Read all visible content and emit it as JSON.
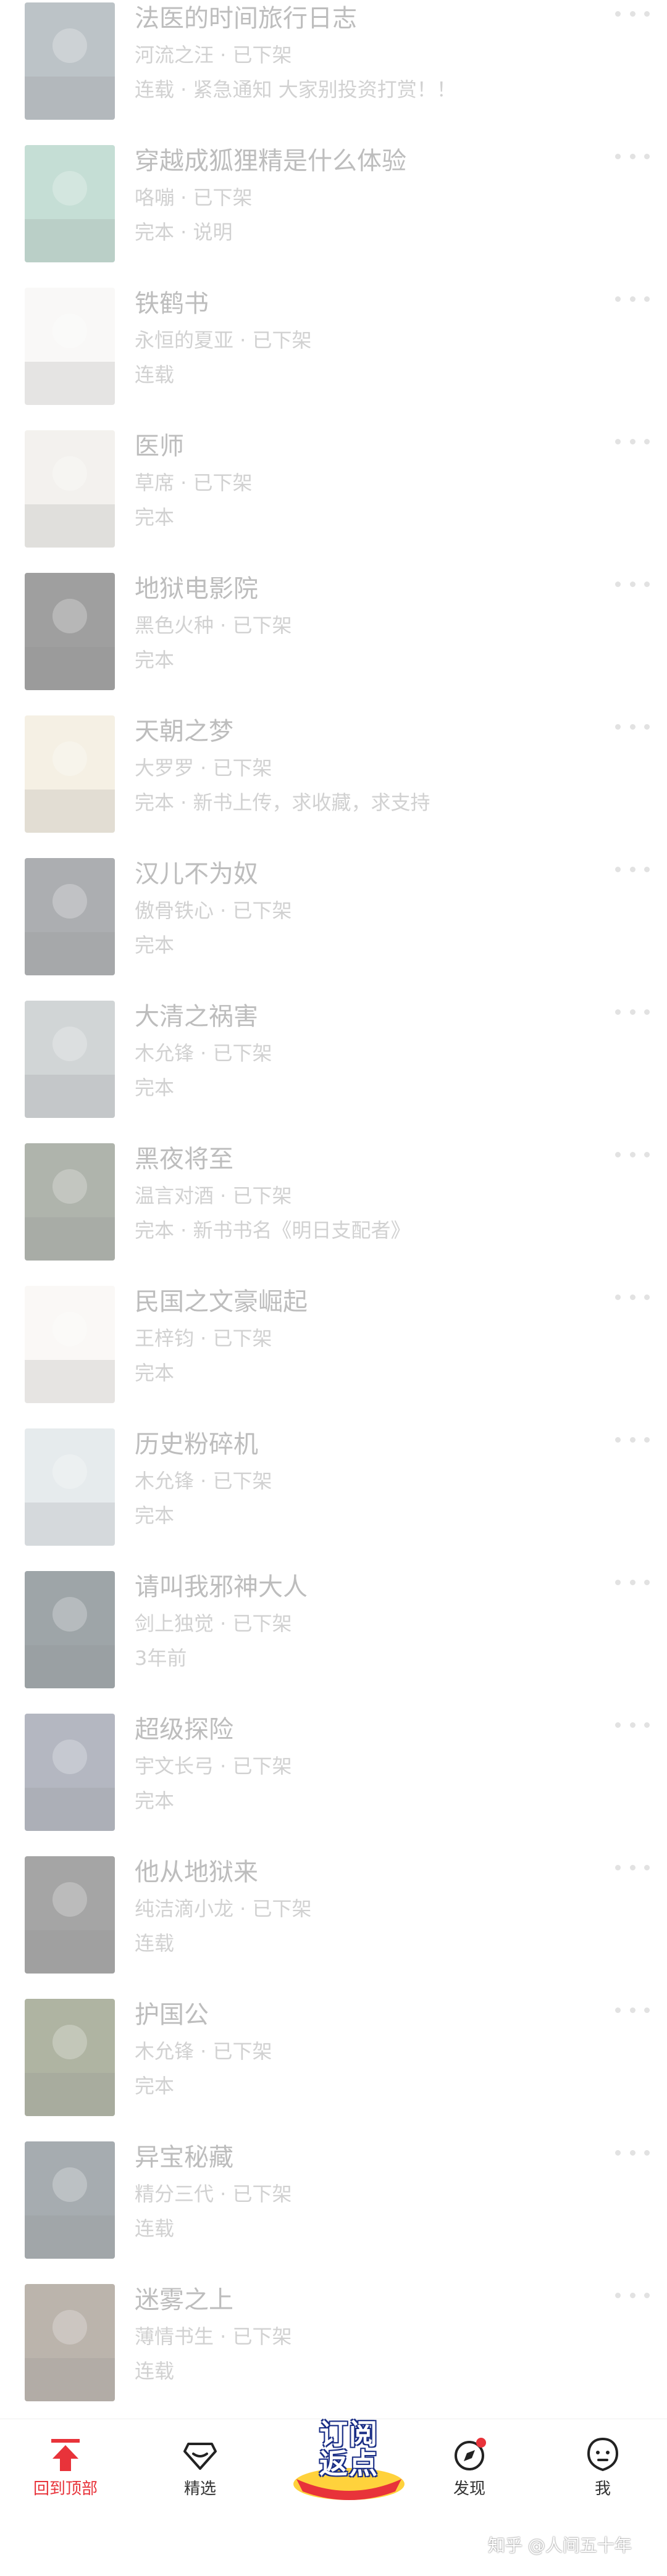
{
  "books": [
    {
      "title": "法医的时间旅行日志",
      "meta": "河流之汪 · 已下架",
      "status": "连载 · 紧急通知 大家别投资打赏！！",
      "cover_color": "#6d7b85"
    },
    {
      "title": "穿越成狐狸精是什么体验",
      "meta": "咯嘣 · 已下架",
      "status": "完本 · 说明",
      "cover_color": "#7fb7a3"
    },
    {
      "title": "铁鹤书",
      "meta": "永恒的夏亚 · 已下架",
      "status": "连载",
      "cover_color": "#f3f1ee"
    },
    {
      "title": "医师",
      "meta": "草席 · 已下架",
      "status": "完本",
      "cover_color": "#e6e2db"
    },
    {
      "title": "地狱电影院",
      "meta": "黑色火种 · 已下架",
      "status": "完本",
      "cover_color": "#2d2d2d"
    },
    {
      "title": "天朝之梦",
      "meta": "大罗罗 · 已下架",
      "status": "完本 · 新书上传，求收藏，求支持",
      "cover_color": "#e9dfc4"
    },
    {
      "title": "汉儿不为奴",
      "meta": "傲骨铁心 · 已下架",
      "status": "完本",
      "cover_color": "#4a4e54"
    },
    {
      "title": "大清之祸害",
      "meta": "木允锋 · 已下架",
      "status": "完本",
      "cover_color": "#9aa3a6"
    },
    {
      "title": "黑夜将至",
      "meta": "温言对酒 · 已下架",
      "status": "完本 · 新书书名《明日支配者》",
      "cover_color": "#4f5a48"
    },
    {
      "title": "民国之文豪崛起",
      "meta": "王梓钧 · 已下架",
      "status": "完本",
      "cover_color": "#f4f1ec"
    },
    {
      "title": "历史粉碎机",
      "meta": "木允锋 · 已下架",
      "status": "完本",
      "cover_color": "#c9d3d9"
    },
    {
      "title": "请叫我邪神大人",
      "meta": "剑上独觉 · 已下架",
      "status": "3年前",
      "cover_color": "#2a3a40"
    },
    {
      "title": "超级探险",
      "meta": "宇文长弓 · 已下架",
      "status": "完本",
      "cover_color": "#5a6278"
    },
    {
      "title": "他从地狱来",
      "meta": "纯洁滴小龙 · 已下架",
      "status": "连载",
      "cover_color": "#3a3a3a"
    },
    {
      "title": "护国公",
      "meta": "木允锋 · 已下架",
      "status": "完本",
      "cover_color": "#4f5b33"
    },
    {
      "title": "异宝秘藏",
      "meta": "精分三代 · 已下架",
      "status": "连载",
      "cover_color": "#3c4a52"
    },
    {
      "title": "迷雾之上",
      "meta": "薄情书生 · 已下架",
      "status": "连载",
      "cover_color": "#6b5a4a"
    }
  ],
  "more_icon": "more-dots-icon",
  "bottom_nav": {
    "items": [
      {
        "label": "回到顶部",
        "icon": "back-to-top-icon",
        "active": true
      },
      {
        "label": "精选",
        "icon": "featured-icon",
        "active": false
      },
      {
        "label": "发现",
        "icon": "compass-icon",
        "active": false
      },
      {
        "label": "我",
        "icon": "profile-icon",
        "active": false
      }
    ],
    "promo": {
      "line1": "订阅",
      "line2": "返点"
    }
  },
  "watermark": "知乎 @人间五十年",
  "colors": {
    "accent": "#e8333a",
    "promo_blue": "#1b2f86"
  }
}
